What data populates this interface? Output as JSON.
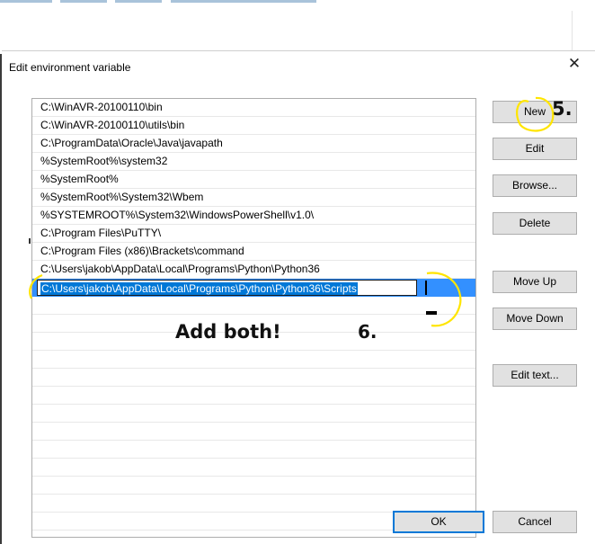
{
  "dialog": {
    "title": "Edit environment variable",
    "close_glyph": "✕"
  },
  "path_entries": [
    "C:\\WinAVR-20100110\\bin",
    "C:\\WinAVR-20100110\\utils\\bin",
    "C:\\ProgramData\\Oracle\\Java\\javapath",
    "%SystemRoot%\\system32",
    "%SystemRoot%",
    "%SystemRoot%\\System32\\Wbem",
    "%SYSTEMROOT%\\System32\\WindowsPowerShell\\v1.0\\",
    "C:\\Program Files\\PuTTY\\",
    "C:\\Program Files (x86)\\Brackets\\command",
    "C:\\Users\\jakob\\AppData\\Local\\Programs\\Python\\Python36"
  ],
  "editing_entry": {
    "value": "C:\\Users\\jakob\\AppData\\Local\\Programs\\Python\\Python36\\Scripts"
  },
  "buttons": {
    "new": "New",
    "edit": "Edit",
    "browse": "Browse...",
    "delete": "Delete",
    "move_up": "Move Up",
    "move_down": "Move Down",
    "edit_text": "Edit text...",
    "ok": "OK",
    "cancel": "Cancel"
  },
  "annotations": {
    "step5": "5.",
    "step6": "6.",
    "add_both": "Add both!"
  },
  "colors": {
    "selection": "#3390ff",
    "highlight_text_bg": "#0078d7",
    "annotation_circle": "#ffe500",
    "default_button_border": "#0078d7"
  }
}
